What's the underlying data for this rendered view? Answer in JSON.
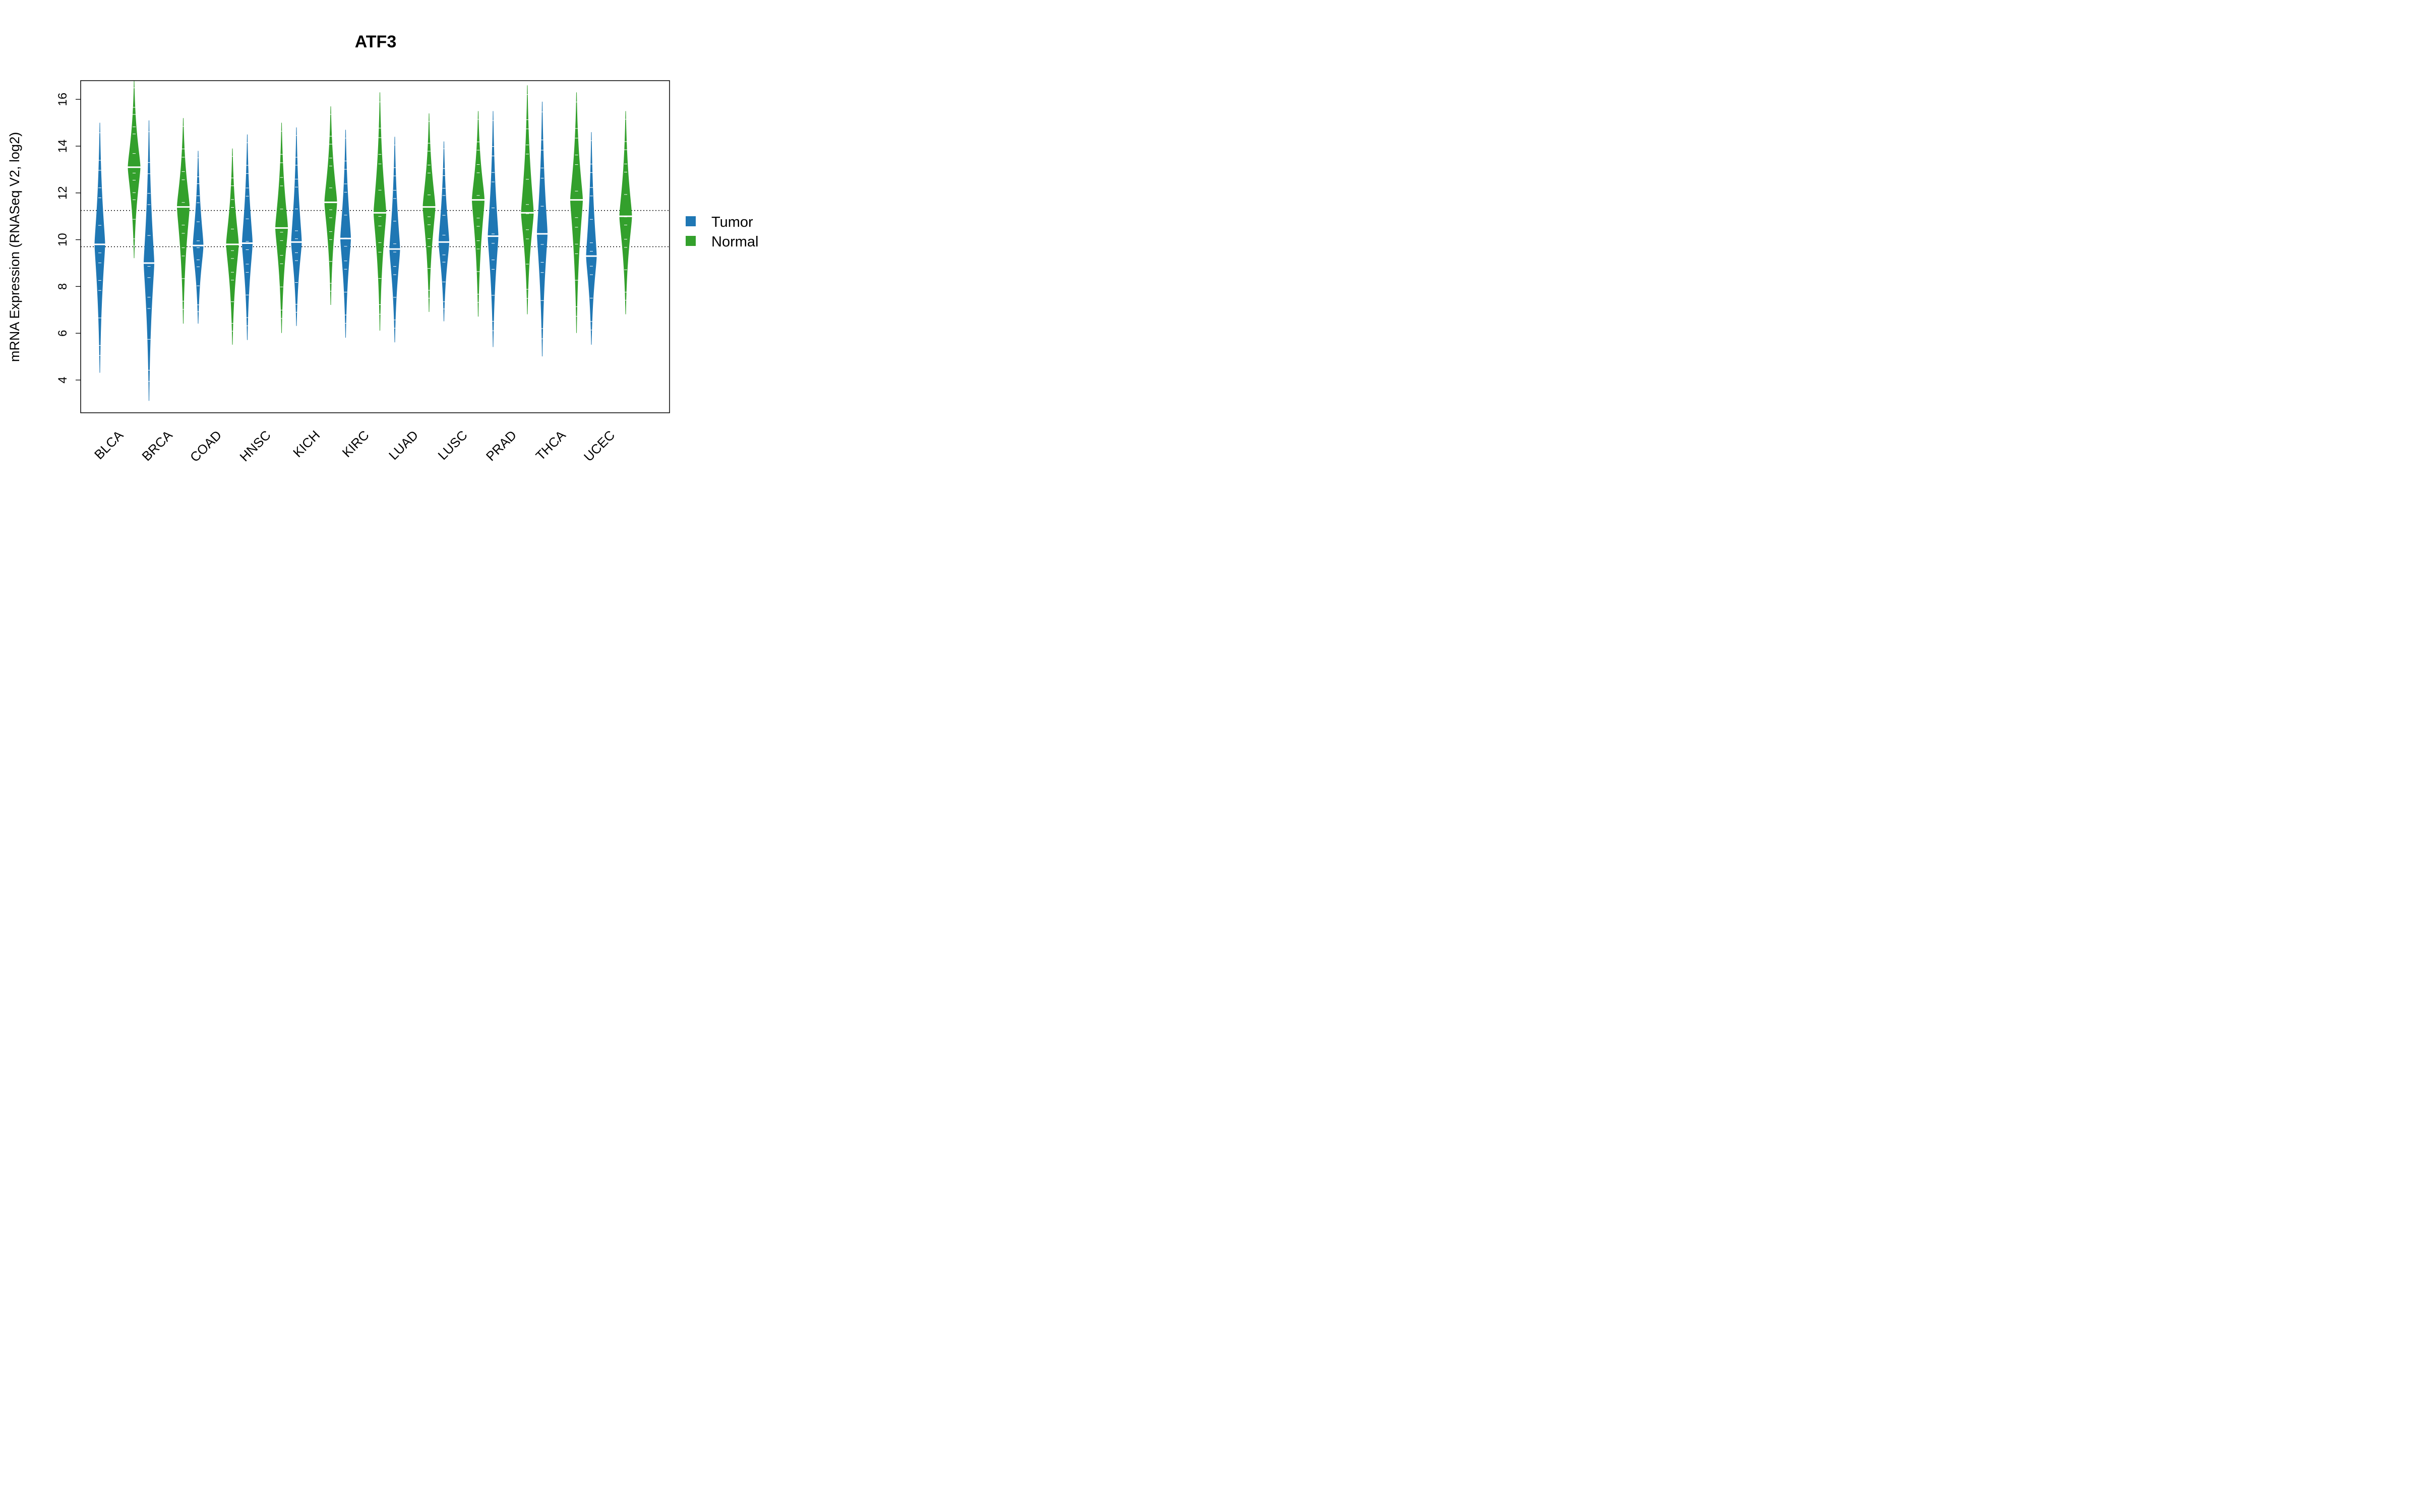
{
  "chart_data": {
    "type": "violin",
    "title": "ATF3",
    "xlabel": "",
    "ylabel": "mRNA Expression (RNASeq V2, log2)",
    "ylim": [
      2.6,
      16.8
    ],
    "yticks": [
      4,
      6,
      8,
      10,
      12,
      14,
      16
    ],
    "grid": false,
    "legend_position": "right",
    "reference_lines": [
      11.25,
      9.7
    ],
    "categories": [
      "BLCA",
      "BRCA",
      "COAD",
      "HNSC",
      "KICH",
      "KIRC",
      "LUAD",
      "LUSC",
      "PRAD",
      "THCA",
      "UCEC"
    ],
    "series": [
      {
        "name": "Tumor",
        "color": "#1f77b4",
        "median": [
          9.8,
          9.0,
          9.75,
          9.85,
          9.9,
          10.05,
          9.6,
          9.9,
          10.15,
          10.25,
          9.3
        ],
        "min": [
          4.3,
          3.1,
          6.4,
          5.7,
          6.3,
          5.8,
          5.6,
          6.5,
          5.4,
          5.0,
          5.5
        ],
        "max": [
          15.0,
          15.1,
          13.8,
          14.5,
          14.8,
          14.7,
          14.4,
          14.2,
          15.5,
          15.9,
          14.6
        ]
      },
      {
        "name": "Normal",
        "color": "#33a02c",
        "median": [
          13.1,
          11.4,
          9.8,
          10.5,
          11.6,
          11.15,
          11.4,
          11.7,
          11.15,
          11.7,
          11.0
        ],
        "min": [
          9.2,
          6.4,
          5.5,
          6.0,
          7.2,
          6.1,
          6.9,
          6.7,
          6.8,
          6.0,
          6.8
        ],
        "max": [
          16.8,
          15.2,
          13.9,
          15.0,
          15.7,
          16.3,
          15.4,
          15.5,
          16.6,
          16.3,
          15.5
        ]
      }
    ],
    "legend": [
      "Tumor",
      "Normal"
    ]
  }
}
